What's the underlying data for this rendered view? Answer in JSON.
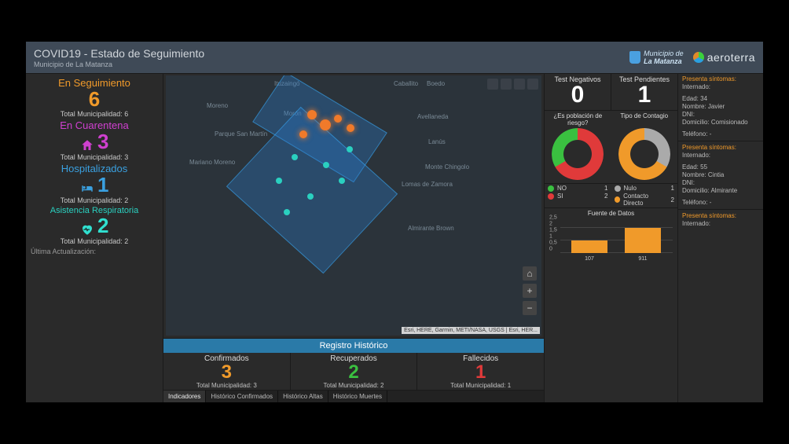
{
  "header": {
    "title": "COVID19 - Estado de Seguimiento",
    "subtitle": "Municipio de La Matanza",
    "brand1_a": "Municipio de",
    "brand1_b": "La Matanza",
    "brand2": "aeroterra"
  },
  "left_panel": {
    "seguimiento": {
      "label": "En Seguimiento",
      "value": "6",
      "sub": "Total Municipalidad: 6"
    },
    "cuarentena": {
      "label": "En Cuarentena",
      "value": "3",
      "sub": "Total Municipalidad: 3"
    },
    "hospitalizados": {
      "label": "Hospitalizados",
      "value": "1",
      "sub": "Total Municipalidad: 2"
    },
    "respiratoria": {
      "label": "Asistencia Respiratoria",
      "value": "2",
      "sub": "Total Municipalidad: 2"
    },
    "last_update_label": "Última Actualización:"
  },
  "map": {
    "places": [
      "Moreno",
      "Ituzaingó",
      "Morón",
      "Caballito",
      "Boedo",
      "Avellaneda",
      "Lanús",
      "Lomas de Zamora",
      "Monte Chingolo",
      "Almirante Brown",
      "Mariano Moreno",
      "Parque San Martín"
    ],
    "controls": {
      "home": "⌂",
      "plus": "+",
      "minus": "−"
    },
    "attribution": "Esri, HERE, Garmin, METI/NASA, USGS | Esri, HER..."
  },
  "historico": {
    "title": "Registro Histórico",
    "conf": {
      "label": "Confirmados",
      "value": "3",
      "sub": "Total Municipalidad: 3"
    },
    "recu": {
      "label": "Recuperados",
      "value": "2",
      "sub": "Total Municipalidad: 2"
    },
    "fall": {
      "label": "Fallecidos",
      "value": "1",
      "sub": "Total Municipalidad: 1"
    },
    "tabs": [
      "Indicadores",
      "Histórico Confirmados",
      "Histórico Altas",
      "Histórico Muertes"
    ]
  },
  "tests": {
    "neg": {
      "label": "Test Negativos",
      "value": "0"
    },
    "pen": {
      "label": "Test Pendientes",
      "value": "1"
    }
  },
  "riesgo": {
    "title": "¿Es población de riesgo?",
    "legend": [
      {
        "color": "#3ac040",
        "label": "NO",
        "value": "1"
      },
      {
        "color": "#e03a3a",
        "label": "SI",
        "value": "2"
      }
    ]
  },
  "contagio": {
    "title": "Tipo de Contagio",
    "legend": [
      {
        "color": "#aaaaaa",
        "label": "Nulo",
        "value": "1"
      },
      {
        "color": "#f09a2a",
        "label": "Contacto Directo",
        "value": "2"
      }
    ]
  },
  "fuente": {
    "title": "Fuente de Datos",
    "yticks": [
      "0",
      "0,5",
      "1",
      "1,5",
      "2",
      "2,5"
    ],
    "bars": [
      {
        "label": "107",
        "value": 1
      },
      {
        "label": "911",
        "value": 2
      }
    ]
  },
  "patients": [
    {
      "pres": "Presenta síntomas:",
      "int": "Internado:",
      "edad": "Edad: 34",
      "nombre": "Nombre: Javier",
      "dni": "DNI: ",
      "dom": "Domicilio: Comisionado",
      "tel": "Teléfono: -"
    },
    {
      "pres": "Presenta síntomas:",
      "int": "Internado:",
      "edad": "Edad: 55",
      "nombre": "Nombre: Cintia",
      "dni": "DNI: ",
      "dom": "Domicilio: Almirante",
      "tel": "Teléfono: -"
    },
    {
      "pres": "Presenta síntomas:",
      "int": "Internado:"
    }
  ],
  "chart_data": [
    {
      "type": "pie",
      "title": "¿Es población de riesgo?",
      "series": [
        {
          "name": "NO",
          "value": 1,
          "color": "#3ac040"
        },
        {
          "name": "SI",
          "value": 2,
          "color": "#e03a3a"
        }
      ]
    },
    {
      "type": "pie",
      "title": "Tipo de Contagio",
      "series": [
        {
          "name": "Nulo",
          "value": 1,
          "color": "#aaaaaa"
        },
        {
          "name": "Contacto Directo",
          "value": 2,
          "color": "#f09a2a"
        }
      ]
    },
    {
      "type": "bar",
      "title": "Fuente de Datos",
      "categories": [
        "107",
        "911"
      ],
      "values": [
        1,
        2
      ],
      "ylim": [
        0,
        2.5
      ]
    }
  ]
}
